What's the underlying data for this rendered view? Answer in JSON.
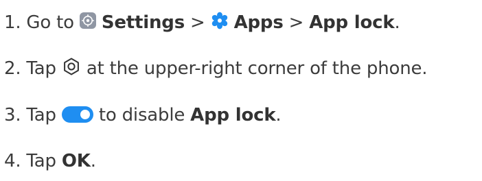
{
  "steps": [
    {
      "number": "1.",
      "go_to": "Go to",
      "settings": "Settings",
      "sep1": ">",
      "apps": "Apps",
      "sep2": ">",
      "app_lock": "App lock",
      "period": "."
    },
    {
      "number": "2.",
      "tap": "Tap",
      "rest": "at the upper-right corner of the phone."
    },
    {
      "number": "3.",
      "tap": "Tap",
      "to_disable": "to disable",
      "app_lock": "App lock",
      "period": "."
    },
    {
      "number": "4.",
      "tap": "Tap",
      "ok": "OK",
      "period": "."
    }
  ],
  "icons": {
    "settings": "settings-app-icon",
    "apps": "apps-gear-icon",
    "upper_right": "settings-ring-icon",
    "toggle": "toggle-switch-on-icon"
  },
  "colors": {
    "text": "#3c3c3c",
    "bold_text": "#333333",
    "accent": "#1f8ef1",
    "settings_tile": "#8f96a3"
  },
  "toggle": {
    "state": "on"
  }
}
